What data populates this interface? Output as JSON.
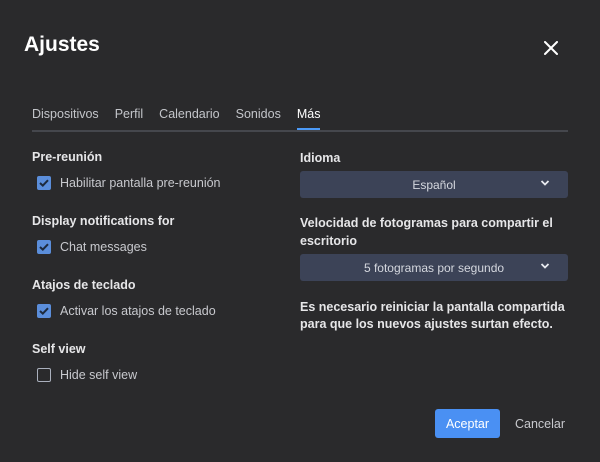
{
  "dialog": {
    "title": "Ajustes",
    "close_icon": "close-icon"
  },
  "tabs": [
    {
      "label": "Dispositivos",
      "active": false
    },
    {
      "label": "Perfil",
      "active": false
    },
    {
      "label": "Calendario",
      "active": false
    },
    {
      "label": "Sonidos",
      "active": false
    },
    {
      "label": "Más",
      "active": true
    }
  ],
  "left": {
    "pre_meeting": {
      "title": "Pre-reunión",
      "option": {
        "label": "Habilitar pantalla pre-reunión",
        "checked": true
      }
    },
    "notifications": {
      "title": "Display notifications for",
      "option": {
        "label": "Chat messages",
        "checked": true
      }
    },
    "shortcuts": {
      "title": "Atajos de teclado",
      "option": {
        "label": "Activar los atajos de teclado",
        "checked": true
      }
    },
    "self_view": {
      "title": "Self view",
      "option": {
        "label": "Hide self view",
        "checked": false
      }
    }
  },
  "right": {
    "language": {
      "label": "Idioma",
      "value": "Español"
    },
    "framerate": {
      "label": "Velocidad de fotogramas para compartir el escritorio",
      "value": "5 fotogramas por segundo"
    },
    "note": "Es necesario reiniciar la pantalla compartida para que los nuevos ajustes surtan efecto."
  },
  "footer": {
    "accept_label": "Aceptar",
    "cancel_label": "Cancelar"
  },
  "colors": {
    "background": "#2a2a2c",
    "accent": "#4a90f3",
    "checkbox": "#5b8edb",
    "select": "#3c4357"
  }
}
